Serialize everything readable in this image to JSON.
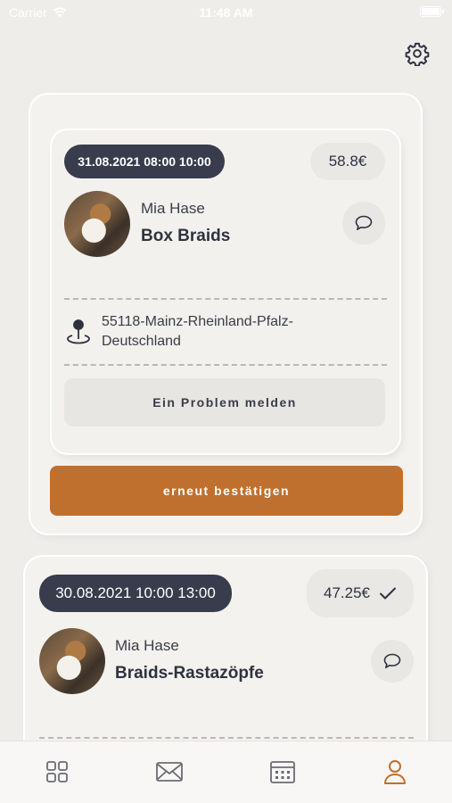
{
  "status_bar": {
    "carrier": "Carrier",
    "time": "11:48 AM"
  },
  "header": {
    "settings_icon": "gear-icon"
  },
  "colors": {
    "background": "#efedea",
    "badge": "#383c4d",
    "accent": "#c0702e",
    "active_tab": "#c0702e"
  },
  "appointments": [
    {
      "datetime": "31.08.2021 08:00 10:00",
      "price": "58.8€",
      "customer_name": "Mia Hase",
      "service": "Box Braids",
      "location": "55118-Mainz-Rheinland-Pfalz-Deutschland",
      "report_problem_label": "Ein Problem melden",
      "confirm_label": "erneut bestätigen"
    },
    {
      "datetime": "30.08.2021 10:00 13:00",
      "price": "47.25€",
      "confirmed": true,
      "customer_name": "Mia Hase",
      "service": "Braids-Rastazöpfe"
    }
  ],
  "tab_bar": {
    "tabs": [
      {
        "icon": "grid-icon",
        "active": false
      },
      {
        "icon": "mail-icon",
        "active": false
      },
      {
        "icon": "calendar-icon",
        "active": false
      },
      {
        "icon": "profile-icon",
        "active": true
      }
    ]
  }
}
